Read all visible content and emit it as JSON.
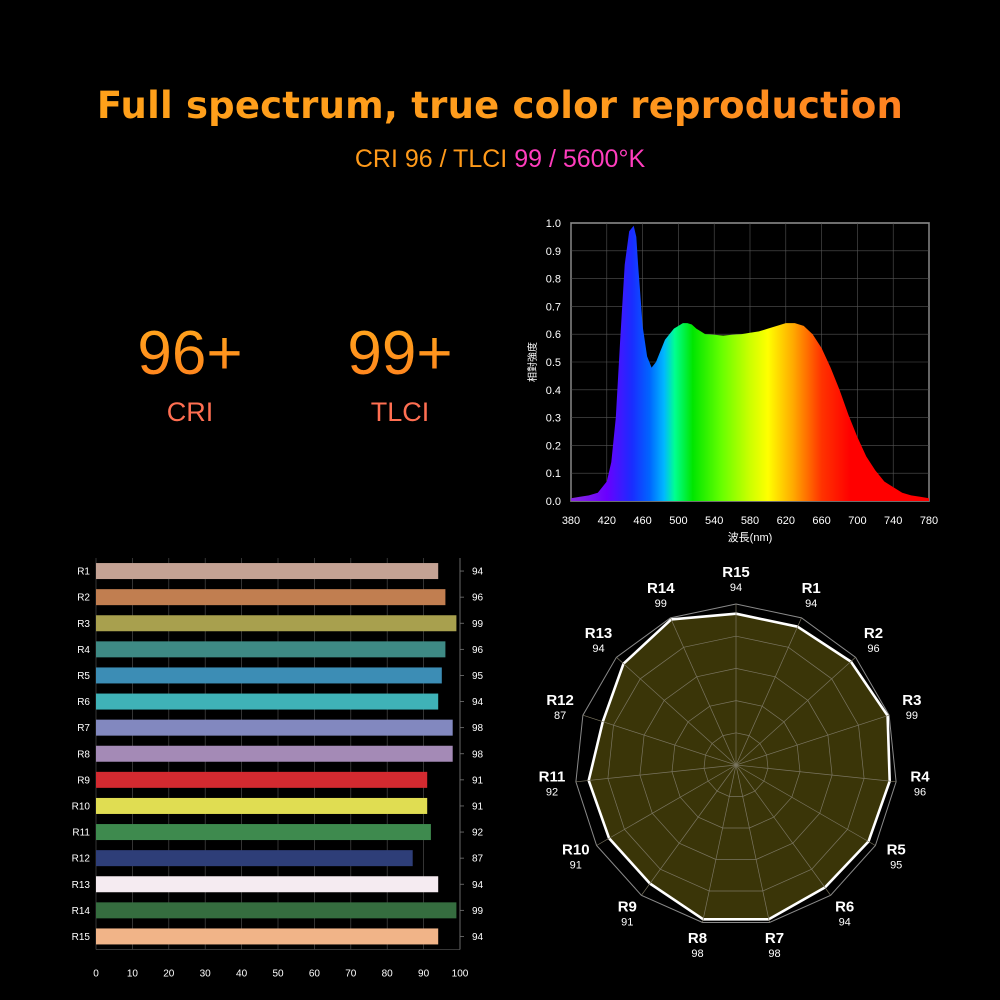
{
  "header": {
    "title": "Full spectrum, true color reproduction",
    "subtitle_part1": "CRI 96 / TLCI ",
    "subtitle_part2": "99 / 5600°K"
  },
  "stats": [
    {
      "value": "96+",
      "label": "CRI"
    },
    {
      "value": "99+",
      "label": "TLCI"
    }
  ],
  "colors": {
    "title": "#ff9a1c",
    "subtitle_orange": "#ff9a1a",
    "subtitle_pink": "#ff3dbd",
    "radar_fill": "#3a3508",
    "radar_stroke": "#ffffff"
  },
  "chart_data": [
    {
      "type": "area",
      "xlabel": "波長(nm)",
      "ylabel": "相對強度",
      "xlim": [
        380,
        780
      ],
      "ylim": [
        0,
        1
      ],
      "x_ticks": [
        380,
        420,
        460,
        500,
        540,
        580,
        620,
        660,
        700,
        740,
        780
      ],
      "y_ticks": [
        "0.0",
        "0.1",
        "0.2",
        "0.3",
        "0.4",
        "0.5",
        "0.6",
        "0.7",
        "0.8",
        "0.9",
        "1.0"
      ],
      "grid": true,
      "x": [
        380,
        390,
        400,
        410,
        420,
        425,
        430,
        435,
        440,
        445,
        450,
        453,
        455,
        458,
        460,
        465,
        470,
        475,
        480,
        485,
        490,
        495,
        500,
        505,
        510,
        515,
        520,
        525,
        530,
        540,
        550,
        560,
        570,
        580,
        590,
        600,
        610,
        620,
        630,
        640,
        650,
        660,
        670,
        680,
        690,
        700,
        710,
        720,
        730,
        740,
        750,
        760,
        770,
        780
      ],
      "y": [
        0.01,
        0.015,
        0.02,
        0.03,
        0.07,
        0.14,
        0.3,
        0.58,
        0.85,
        0.97,
        0.99,
        0.95,
        0.85,
        0.72,
        0.63,
        0.52,
        0.48,
        0.5,
        0.54,
        0.58,
        0.6,
        0.62,
        0.63,
        0.64,
        0.64,
        0.635,
        0.62,
        0.61,
        0.6,
        0.598,
        0.595,
        0.598,
        0.6,
        0.605,
        0.61,
        0.62,
        0.63,
        0.64,
        0.64,
        0.63,
        0.6,
        0.55,
        0.48,
        0.4,
        0.31,
        0.23,
        0.16,
        0.11,
        0.07,
        0.05,
        0.03,
        0.02,
        0.015,
        0.01
      ]
    },
    {
      "type": "bar",
      "orientation": "horizontal",
      "categories": [
        "R1",
        "R2",
        "R3",
        "R4",
        "R5",
        "R6",
        "R7",
        "R8",
        "R9",
        "R10",
        "R11",
        "R12",
        "R13",
        "R14",
        "R15"
      ],
      "values": [
        94,
        96,
        99,
        96,
        95,
        94,
        98,
        98,
        91,
        91,
        92,
        87,
        94,
        99,
        94
      ],
      "colors": [
        "#c4a294",
        "#c17e50",
        "#a8a04e",
        "#3e8a85",
        "#3c8db5",
        "#3fb2b7",
        "#8288bf",
        "#a48ab6",
        "#d32a30",
        "#e0dd52",
        "#3e8a4e",
        "#2e3e78",
        "#f5ebf1",
        "#356d3f",
        "#f1b488"
      ],
      "xlim": [
        0,
        100
      ],
      "x_ticks": [
        0,
        10,
        20,
        30,
        40,
        50,
        60,
        70,
        80,
        90,
        100
      ],
      "grid": true
    },
    {
      "type": "radar",
      "categories": [
        "R15",
        "R1",
        "R2",
        "R3",
        "R4",
        "R5",
        "R6",
        "R7",
        "R8",
        "R9",
        "R10",
        "R11",
        "R12",
        "R13",
        "R14"
      ],
      "values": [
        94,
        94,
        96,
        99,
        96,
        95,
        94,
        98,
        98,
        91,
        91,
        92,
        87,
        94,
        99
      ],
      "rlim": [
        0,
        100
      ]
    }
  ]
}
